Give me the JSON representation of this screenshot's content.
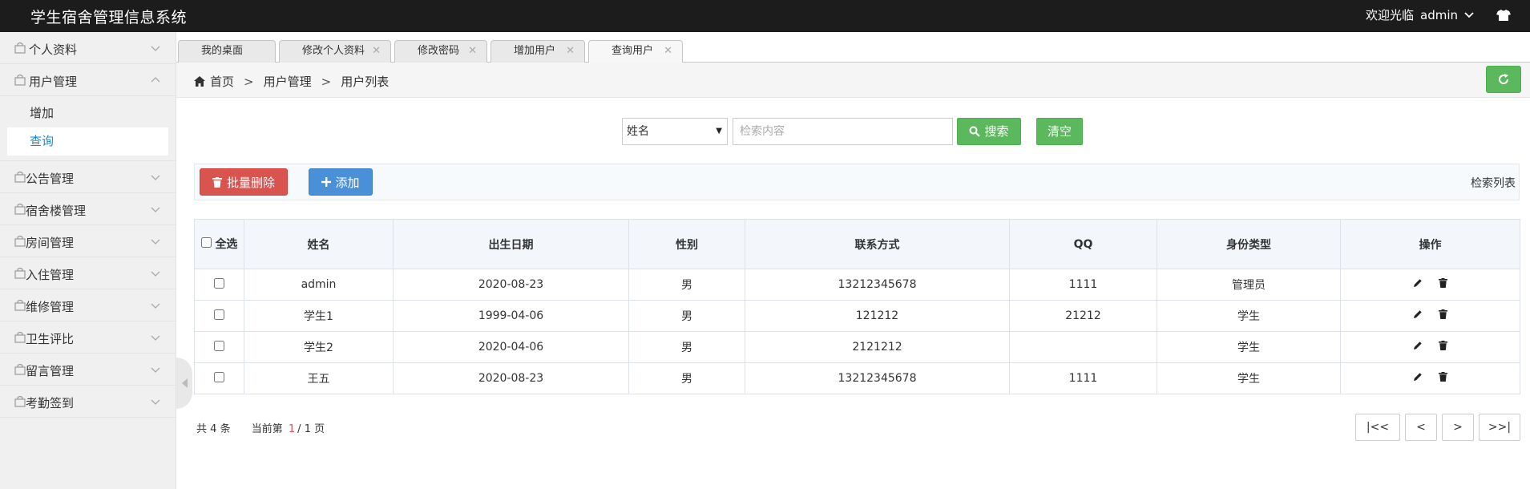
{
  "header": {
    "app_title": "学生宿舍管理信息系统",
    "welcome": "欢迎光临",
    "username": "admin"
  },
  "sidebar": {
    "items": [
      {
        "label": "个人资料",
        "expanded": false
      },
      {
        "label": "用户管理",
        "expanded": true,
        "children": [
          {
            "label": "增加",
            "active": false
          },
          {
            "label": "查询",
            "active": true
          }
        ]
      },
      {
        "label": "公告管理",
        "expanded": false
      },
      {
        "label": "宿舍楼管理",
        "expanded": false
      },
      {
        "label": "房间管理",
        "expanded": false
      },
      {
        "label": "入住管理",
        "expanded": false
      },
      {
        "label": "维修管理",
        "expanded": false
      },
      {
        "label": "卫生评比",
        "expanded": false
      },
      {
        "label": "留言管理",
        "expanded": false
      },
      {
        "label": "考勤签到",
        "expanded": false
      }
    ]
  },
  "tabs": [
    {
      "label": "我的桌面",
      "closable": false,
      "active": false
    },
    {
      "label": "修改个人资料",
      "closable": true,
      "active": false
    },
    {
      "label": "修改密码",
      "closable": true,
      "active": false
    },
    {
      "label": "增加用户",
      "closable": true,
      "active": false
    },
    {
      "label": "查询用户",
      "closable": true,
      "active": true
    }
  ],
  "breadcrumb": {
    "home": "首页",
    "sep": ">",
    "level1": "用户管理",
    "level2": "用户列表"
  },
  "search": {
    "field_selected": "姓名",
    "placeholder": "检索内容",
    "search_label": "搜索",
    "clear_label": "清空"
  },
  "toolbar": {
    "batch_delete_label": "批量删除",
    "add_label": "添加",
    "list_title": "检索列表"
  },
  "table": {
    "select_all_label": "全选",
    "columns": [
      "姓名",
      "出生日期",
      "性别",
      "联系方式",
      "QQ",
      "身份类型",
      "操作"
    ],
    "rows": [
      {
        "name": "admin",
        "birth": "2020-08-23",
        "gender": "男",
        "phone": "13212345678",
        "qq": "1111",
        "role": "管理员"
      },
      {
        "name": "学生1",
        "birth": "1999-04-06",
        "gender": "男",
        "phone": "121212",
        "qq": "21212",
        "role": "学生"
      },
      {
        "name": "学生2",
        "birth": "2020-04-06",
        "gender": "男",
        "phone": "2121212",
        "qq": "",
        "role": "学生"
      },
      {
        "name": "王五",
        "birth": "2020-08-23",
        "gender": "男",
        "phone": "13212345678",
        "qq": "1111",
        "role": "学生"
      }
    ]
  },
  "pagination": {
    "total_prefix": "共",
    "total": "4",
    "total_suffix": "条",
    "current_prefix": "当前第",
    "current": "1",
    "slash": "/",
    "pages": "1",
    "pages_suffix": "页",
    "first": "|<<",
    "prev": "<",
    "next": ">",
    "last": ">>|"
  },
  "colors": {
    "topbar": "#1c1c1c",
    "success": "#5cb85c",
    "danger": "#d9534f",
    "primary": "#4a90d9",
    "link_active": "#1e88d4"
  }
}
